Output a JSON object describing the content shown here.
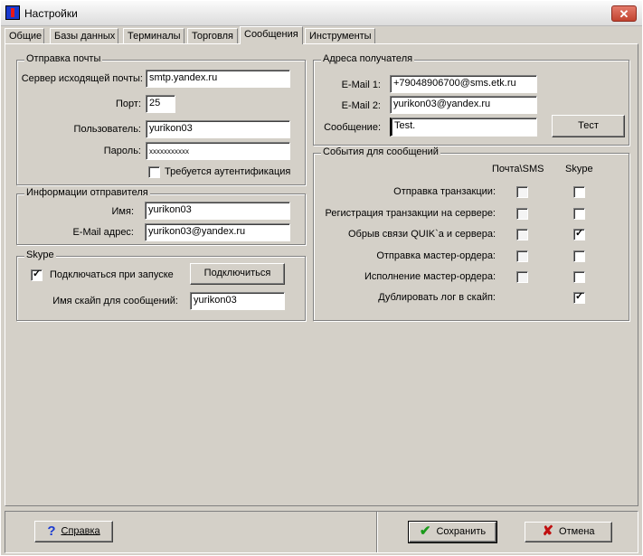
{
  "window": {
    "title": "Настройки",
    "close_glyph": "✕"
  },
  "tabs": [
    "Общие",
    "Базы данных",
    "Терминалы",
    "Торговля",
    "Сообщения",
    "Инструменты"
  ],
  "mail_send": {
    "title": "Отправка почты",
    "server_label": "Сервер исходящей почты:",
    "server_value": "smtp.yandex.ru",
    "port_label": "Порт:",
    "port_value": "25",
    "user_label": "Пользователь:",
    "user_value": "yurikon03",
    "password_label": "Пароль:",
    "password_value": "xxxxxxxxxxx",
    "auth_label": "Требуется аутентификация",
    "auth_checked": false
  },
  "sender": {
    "title": "Информации отправителя",
    "name_label": "Имя:",
    "name_value": "yurikon03",
    "email_label": "E-Mail адрес:",
    "email_value": "yurikon03@yandex.ru"
  },
  "skype": {
    "title": "Skype",
    "connect_label": "Подключаться при запуске",
    "connect_checked": true,
    "connect_button": "Подключиться",
    "name_label": "Имя скайп для сообщений:",
    "name_value": "yurikon03"
  },
  "recipient": {
    "title": "Адреса получателя",
    "email1_label": "E-Mail 1:",
    "email1_value": "+79048906700@sms.etk.ru",
    "email2_label": "E-Mail 2:",
    "email2_value": "yurikon03@yandex.ru",
    "message_label": "Сообщение:",
    "message_value": "Test.",
    "test_button": "Тест"
  },
  "events": {
    "title": "События для сообщений",
    "col_mail": "Почта\\SMS",
    "col_skype": "Skype",
    "rows": [
      {
        "label": "Отправка транзакции:",
        "mail": false,
        "skype": false
      },
      {
        "label": "Регистрация транзакции на сервере:",
        "mail": false,
        "skype": false
      },
      {
        "label": "Обрыв связи QUIK`a и сервера:",
        "mail": false,
        "skype": true
      },
      {
        "label": "Отправка мастер-ордера:",
        "mail": false,
        "skype": false
      },
      {
        "label": "Исполнение мастер-ордера:",
        "mail": false,
        "skype": false
      },
      {
        "label": "Дублировать лог в скайп:",
        "mail": null,
        "skype": true
      }
    ]
  },
  "footer": {
    "help_button": "Справка",
    "save_button": "Сохранить",
    "cancel_button": "Отмена",
    "help_icon": "question-icon",
    "save_icon": "checkmark-icon",
    "cancel_icon": "x-icon"
  },
  "colors": {
    "check_icon": "#1a9a1a",
    "cancel_icon": "#c01010",
    "help_icon": "#1a3ad0"
  }
}
